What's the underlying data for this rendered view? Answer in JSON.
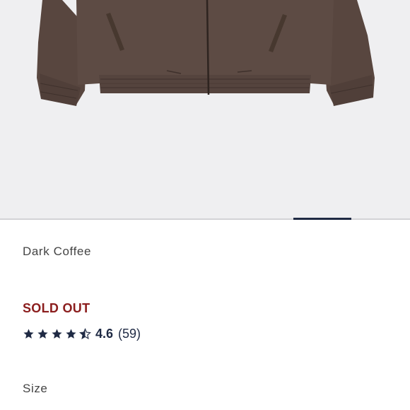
{
  "product": {
    "color_name": "Dark Coffee",
    "availability": "SOLD OUT",
    "size_label": "Size",
    "image": {
      "alt": "Dark coffee brown zip bomber jacket"
    }
  },
  "rating": {
    "value": "4.6",
    "count": "(59)",
    "stars": 4.5,
    "star_icon": "star-icon"
  },
  "carousel": {
    "active_index": 2,
    "indicator_color": "#1f2a44"
  },
  "colors": {
    "image_background": "#efeff1",
    "sold_out": "#8b1d1d",
    "accent": "#1f2a44",
    "jacket": "#5b4942"
  }
}
